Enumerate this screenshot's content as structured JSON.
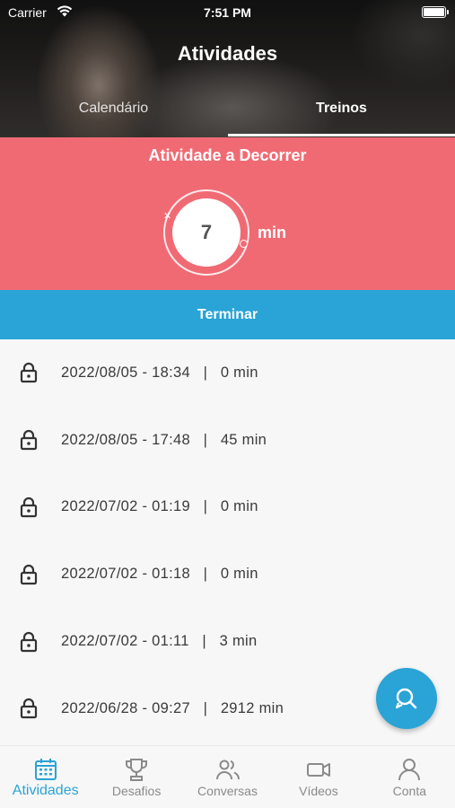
{
  "status_bar": {
    "carrier": "Carrier",
    "time": "7:51 PM"
  },
  "header": {
    "title": "Atividades",
    "tabs": [
      {
        "label": "Calendário",
        "active": false
      },
      {
        "label": "Treinos",
        "active": true
      }
    ]
  },
  "current_activity": {
    "heading": "Atividade a Decorrer",
    "minutes": "7",
    "unit": "min",
    "finish_label": "Terminar"
  },
  "history": [
    {
      "text": "2022/08/05 - 18:34   |   0 min",
      "icon": "lock-icon"
    },
    {
      "text": "2022/08/05 - 17:48   |   45 min",
      "icon": "lock-icon"
    },
    {
      "text": "2022/07/02 - 01:19   |   0 min",
      "icon": "lock-icon"
    },
    {
      "text": "2022/07/02 - 01:18   |   0 min",
      "icon": "lock-icon"
    },
    {
      "text": "2022/07/02 - 01:11   |   3 min",
      "icon": "lock-icon"
    },
    {
      "text": "2022/06/28 - 09:27   |   2912 min",
      "icon": "lock-icon"
    }
  ],
  "fab": {
    "icon": "search-chat-icon"
  },
  "tabbar": [
    {
      "label": "Atividades",
      "icon": "calendar-icon",
      "active": true
    },
    {
      "label": "Desafios",
      "icon": "trophy-icon",
      "active": false
    },
    {
      "label": "Conversas",
      "icon": "users-icon",
      "active": false
    },
    {
      "label": "Vídeos",
      "icon": "video-camera-icon",
      "active": false
    },
    {
      "label": "Conta",
      "icon": "user-icon",
      "active": false
    }
  ],
  "colors": {
    "accent": "#2aa3d6",
    "activity_bg": "#f06a74",
    "text": "#3a3a3a",
    "inactive": "#8a8a8a"
  }
}
